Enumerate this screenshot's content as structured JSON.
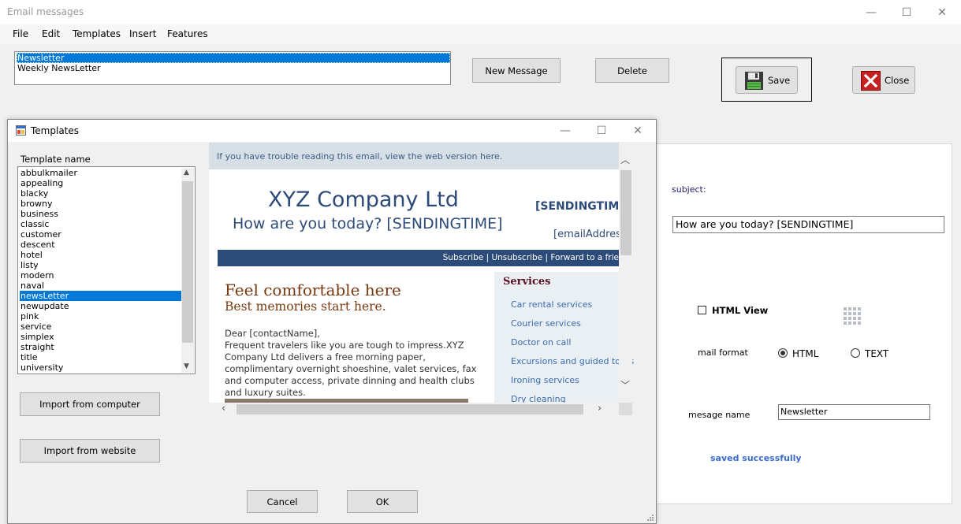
{
  "window": {
    "title": "Email messages",
    "minimize_glyph": "—",
    "maximize_glyph": "☐",
    "close_glyph": "✕"
  },
  "menu": [
    "File",
    "Edit",
    "Templates",
    "Insert",
    "Features"
  ],
  "messages": {
    "items": [
      "Newsletter",
      "Weekly NewsLetter"
    ],
    "selected": "Newsletter"
  },
  "toolbar": {
    "new_message": "New Message",
    "delete": "Delete",
    "save": "Save",
    "close": "Close"
  },
  "editor": {
    "subject_label": "subject:",
    "subject_value": "How are you today?  [SENDINGTIME]",
    "html_view_label": "HTML View",
    "html_view_checked": false,
    "mail_format_label": "mail format",
    "format_options": [
      "HTML",
      "TEXT"
    ],
    "format_selected": "HTML",
    "message_name_label": "mesage name",
    "message_name_value": "Newsletter",
    "status": "saved successfully"
  },
  "templates_dialog": {
    "title": "Templates",
    "list_label": "Template name",
    "templates": [
      "abbulkmailer",
      "appealing",
      "blacky",
      "browny",
      "business",
      "classic",
      "customer",
      "descent",
      "hotel",
      "listy",
      "modern",
      "naval",
      "newsLetter",
      "newupdate",
      "pink",
      "service",
      "simplex",
      "straight",
      "title",
      "university"
    ],
    "selected": "newsLetter",
    "import_computer": "Import from computer",
    "import_website": "Import from website",
    "cancel": "Cancel",
    "ok": "OK",
    "preview": {
      "banner": "If you have trouble reading this email, view the web version here.",
      "company": "XYZ Company Ltd",
      "tagline": "How are you today? [SENDINGTIME]",
      "sendingtime": "[SENDINGTIME",
      "email": "[emailAddres",
      "nav_links": "Subscribe | Unsubscribe | Forward to a frie",
      "headline": "Feel comfortable here",
      "subheadline": "Best memories start here.",
      "greeting": "Dear [contactName],",
      "body_lines": [
        "Frequent travelers like you are tough to impress.XYZ",
        "Company Ltd delivers a free morning paper,",
        "complimentary overnight shoeshine, valet services, fax",
        "and computer access, private dinning and health clubs",
        "and luxury suites."
      ],
      "services_title": "Services",
      "services": [
        "Car rental services",
        "Courier services",
        "Doctor on call",
        "Excursions and guided tours",
        "Ironing services",
        "Dry cleaning"
      ]
    }
  },
  "colors": {
    "selection": "#0078d7",
    "nav_bar": "#2d4b78",
    "company_text": "#2d4b78",
    "headline_text": "#7a3a10",
    "service_link": "#3a6cae",
    "status_text": "#3a6cd0"
  }
}
